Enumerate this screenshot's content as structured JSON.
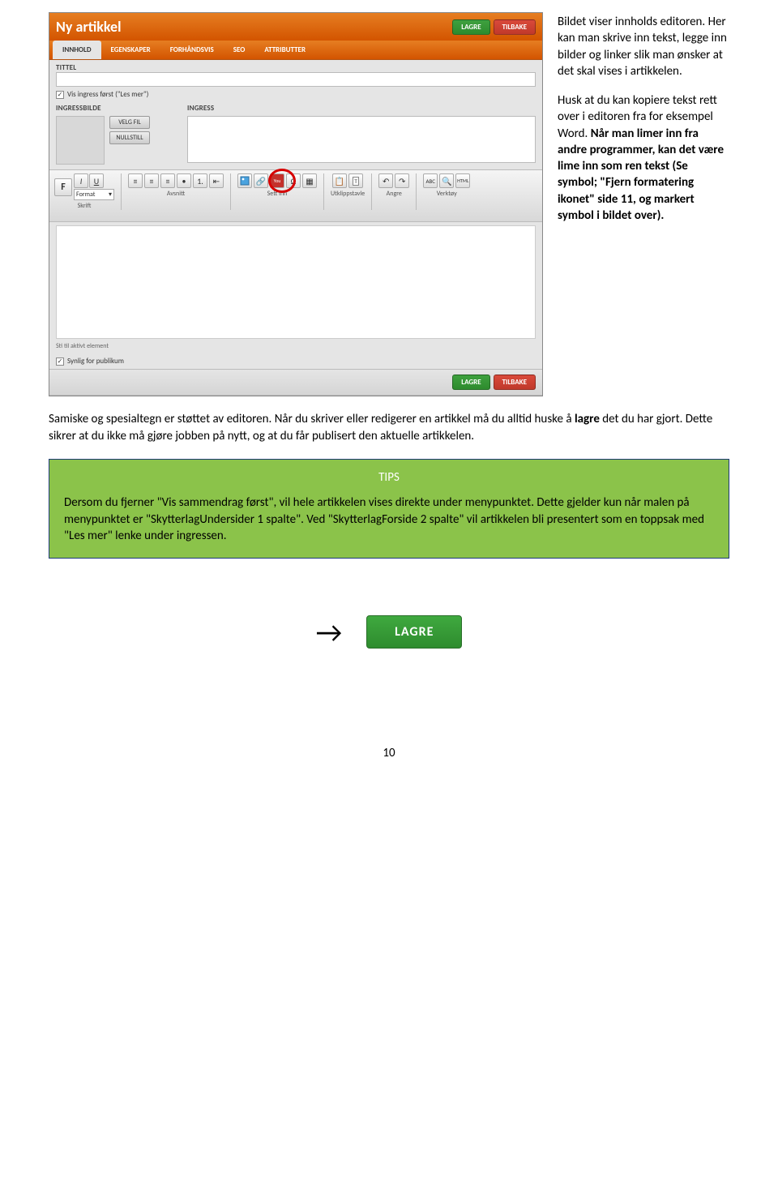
{
  "editor": {
    "title": "Ny artikkel",
    "header_buttons": {
      "save": "LAGRE",
      "back": "TILBAKE"
    },
    "tabs": [
      "INNHOLD",
      "EGENSKAPER",
      "FORHÅNDSVIS",
      "SEO",
      "ATTRIBUTTER"
    ],
    "labels": {
      "tittel": "TITTEL",
      "vis_ingress": "Vis ingress først (\"Les mer\")",
      "ingressbilde": "INGRESSBILDE",
      "ingress": "INGRESS",
      "velg_fil": "VELG FIL",
      "nullstill": "NULLSTILL",
      "format": "Format",
      "skrift": "Skrift",
      "avsnitt": "Avsnitt",
      "settinn": "Sett inn",
      "utklipp": "Utklippstavle",
      "angre": "Angre",
      "verktoy": "Verktøy",
      "aktivt": "Sti til aktivt element",
      "synlig": "Synlig for publikum"
    },
    "footer_buttons": {
      "save": "LAGRE",
      "back": "TILBAKE"
    }
  },
  "side": {
    "p1": "Bildet viser innholds editoren. Her kan man skrive inn tekst, legge inn bilder og linker slik man ønsker at det skal vises i artikkelen.",
    "p2a": "Husk at du kan kopiere tekst rett over i editoren fra for eksempel Word. ",
    "p2b": "Når man limer inn fra andre programmer, kan det være lime inn som ren tekst (Se symbol; \"Fjern formatering ikonet\" side 11, og markert symbol i bildet over)."
  },
  "body": {
    "p1a": "Samiske og spesialtegn er støttet av editoren. Når du skriver eller redigerer en artikkel må du alltid huske å ",
    "p1bold": "lagre",
    "p1b": " det du har gjort. Dette sikrer at du ikke må gjøre jobben på nytt, og at du får publisert den aktuelle artikkelen."
  },
  "tips": {
    "title": "TIPS",
    "text": "Dersom du fjerner \"Vis sammendrag først\", vil hele artikkelen vises direkte under menypunktet. Dette gjelder kun når malen på menypunktet er \"SkytterlagUndersider 1 spalte\". Ved \"SkytterlagForside 2 spalte\" vil artikkelen bli presentert som en toppsak med \"Les mer\" lenke under ingressen."
  },
  "big_lagre": "LAGRE",
  "page_number": "10"
}
